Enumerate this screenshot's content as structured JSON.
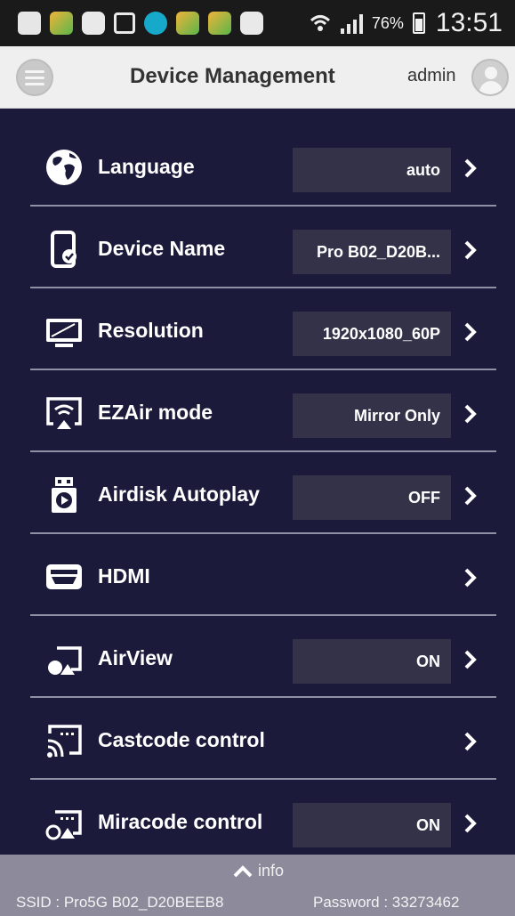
{
  "status_bar": {
    "battery_percent": "76%",
    "time": "13:51",
    "icons": [
      "message-icon",
      "app-icon",
      "s-icon",
      "square-icon",
      "check-icon",
      "app-icon",
      "app-icon",
      "s-icon",
      "wifi-icon",
      "signal-icon",
      "battery-icon"
    ]
  },
  "header": {
    "title": "Device Management",
    "user": "admin"
  },
  "settings": [
    {
      "label": "Language",
      "value": "auto",
      "icon": "globe-icon"
    },
    {
      "label": "Device Name",
      "value": "Pro B02_D20B...",
      "icon": "tablet-icon"
    },
    {
      "label": "Resolution",
      "value": "1920x1080_60P",
      "icon": "monitor-icon"
    },
    {
      "label": "EZAir mode",
      "value": "Mirror Only",
      "icon": "airplay-icon"
    },
    {
      "label": "Airdisk Autoplay",
      "value": "OFF",
      "icon": "airdisk-icon"
    },
    {
      "label": "HDMI",
      "value": "",
      "icon": "hdmi-icon"
    },
    {
      "label": "AirView",
      "value": "ON",
      "icon": "airview-icon"
    },
    {
      "label": "Castcode control",
      "value": "",
      "icon": "cast-icon"
    },
    {
      "label": "Miracode control",
      "value": "ON",
      "icon": "miracast-icon"
    }
  ],
  "footer": {
    "info_label": "info",
    "ssid": "SSID : Pro5G B02_D20BEEB8",
    "password": "Password : 33273462"
  },
  "colors": {
    "background": "#1b1a3a",
    "value_box": "#343248",
    "footer": "#8c8a9b",
    "header": "#efefef"
  }
}
